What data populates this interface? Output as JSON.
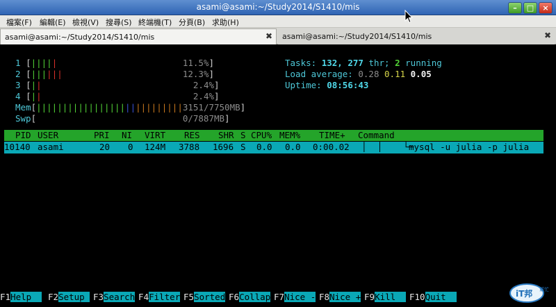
{
  "window": {
    "title": "asami@asami:~/Study2014/S1410/mis",
    "buttons": {
      "minimize": "–",
      "maximize": "□",
      "close": "×"
    }
  },
  "menu": [
    "檔案(F)",
    "編輯(E)",
    "檢視(V)",
    "搜尋(S)",
    "終端機(T)",
    "分頁(B)",
    "求助(H)"
  ],
  "tabs": [
    {
      "label": "asami@asami:~/Study2014/S1410/mis",
      "close_icon": "close-icon"
    },
    {
      "label": "asami@asami:~/Study2014/S1410/mis",
      "close_icon": "close-icon"
    }
  ],
  "htop": {
    "cpus": [
      {
        "label": "1",
        "percent": "11.5%"
      },
      {
        "label": "2",
        "percent": "12.3%"
      },
      {
        "label": "3",
        "percent": "2.4%"
      },
      {
        "label": "4",
        "percent": "2.4%"
      }
    ],
    "mem": {
      "label": "Mem",
      "value": "3151/7750MB"
    },
    "swp": {
      "label": "Swp",
      "value": "0/7887MB"
    },
    "tasks": {
      "label": "Tasks:",
      "count": "132,",
      "threads": "277",
      "thr_label": "thr;",
      "running": "2",
      "running_label": "running"
    },
    "load": {
      "label": "Load average:",
      "v1": "0.28",
      "v2": "0.11",
      "v3": "0.05"
    },
    "uptime": {
      "label": "Uptime:",
      "value": "08:56:43"
    },
    "columns": [
      "PID",
      "USER",
      "PRI",
      "NI",
      "VIRT",
      "RES",
      "SHR",
      "S",
      "CPU%",
      "MEM%",
      "TIME+",
      "Command"
    ],
    "process": {
      "pid": "10140",
      "user": "asami",
      "pri": "20",
      "ni": "0",
      "virt": "124M",
      "res": "3788",
      "shr": "1696",
      "s": "S",
      "cpu": "0.0",
      "mem": "0.0",
      "time": "0:00.02",
      "tree": "│  │    └─",
      "command": "mysql -u julia -p julia"
    },
    "fkeys": [
      {
        "num": "F1",
        "label": "Help  "
      },
      {
        "num": "F2",
        "label": "Setup "
      },
      {
        "num": "F3",
        "label": "Search"
      },
      {
        "num": "F4",
        "label": "Filter"
      },
      {
        "num": "F5",
        "label": "Sorted"
      },
      {
        "num": "F6",
        "label": "Collap"
      },
      {
        "num": "F7",
        "label": "Nice -"
      },
      {
        "num": "F8",
        "label": "Nice +"
      },
      {
        "num": "F9",
        "label": "Kill  "
      },
      {
        "num": "F10",
        "label": "Quit  "
      }
    ]
  },
  "watermark": {
    "text": "iT邦",
    "sub": "幫忙"
  },
  "colors": {
    "header_bg": "#24a42a",
    "selected_bg": "#0aa8b6",
    "accent": "#4ec8d8"
  }
}
